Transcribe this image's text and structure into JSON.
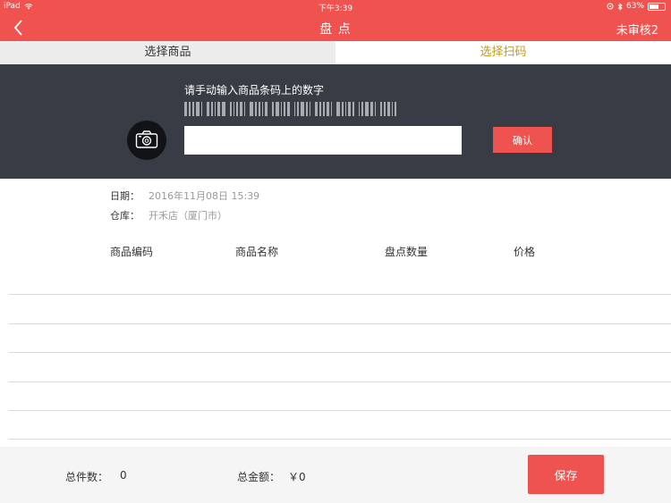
{
  "status_bar": {
    "device": "iPad",
    "time": "下午3:39",
    "battery": "63%",
    "battery_level": 0.63
  },
  "nav": {
    "title": "盘 点",
    "right_label": "未审核2"
  },
  "tabs": [
    {
      "label": "选择商品",
      "active": false
    },
    {
      "label": "选择扫码",
      "active": true
    }
  ],
  "scan": {
    "prompt": "请手动输入商品条码上的数字",
    "input_value": "",
    "confirm_label": "确认"
  },
  "info": {
    "date_label": "日期：",
    "date_value": "2016年11月08日 15:39",
    "store_label": "仓库：",
    "store_value": "开禾店（厦门市）"
  },
  "table": {
    "columns": [
      "商品编码",
      "商品名称",
      "盘点数量",
      "价格"
    ],
    "rows": []
  },
  "footer": {
    "total_count_label": "总件数：",
    "total_count_value": "0",
    "total_amount_label": "总金额：",
    "total_amount_value": "￥0",
    "save_label": "保存"
  },
  "colors": {
    "accent": "#f0524f",
    "active_tab_text": "#c29a1e",
    "scan_panel_bg": "#383c44"
  },
  "icons": [
    "back-chevron-icon",
    "wifi-icon",
    "location-icon",
    "bluetooth-icon",
    "battery-icon",
    "camera-icon",
    "barcode-icon"
  ]
}
